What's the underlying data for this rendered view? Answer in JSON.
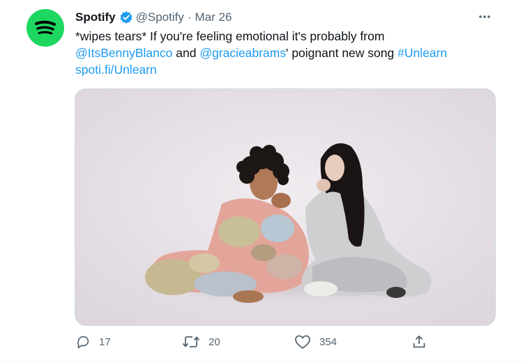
{
  "tweet": {
    "author_name": "Spotify",
    "handle": "@Spotify",
    "separator": "·",
    "date": "Mar 26",
    "text_line1": "*wipes tears* If you're feeling emotional it's probably from",
    "mention1": "@ItsBennyBlanco",
    "and_text": " and ",
    "mention2": "@gracieabrams",
    "line2_rest": "' poignant new song ",
    "hashtag": "#Unlearn",
    "url": "spoti.fi/Unlearn"
  },
  "actions": {
    "replies": "17",
    "retweets": "20",
    "likes": "354"
  },
  "colors": {
    "brand": "#1ed760",
    "link": "#1d9bf0",
    "muted": "#536471",
    "verified": "#1d9bf0"
  },
  "icons": [
    "spotify-logo-icon",
    "verified-badge-icon",
    "more-options-icon",
    "reply-icon",
    "retweet-icon",
    "like-icon",
    "share-icon"
  ]
}
